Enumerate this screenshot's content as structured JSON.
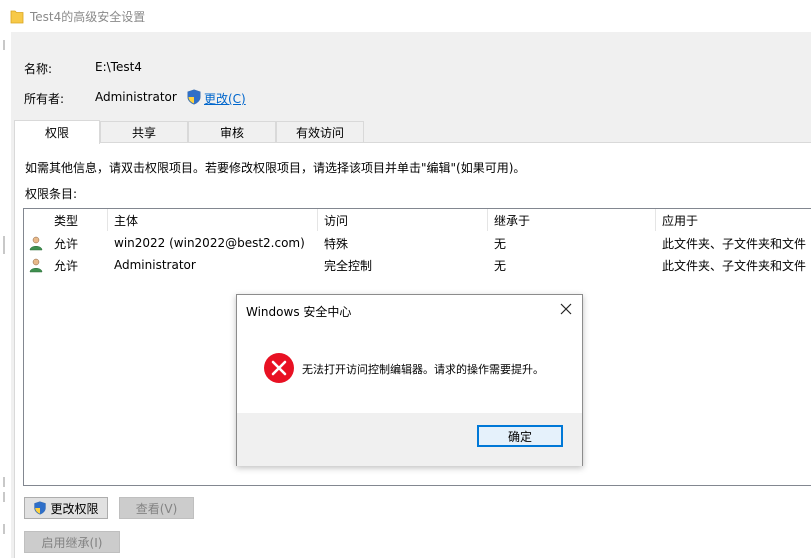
{
  "window": {
    "title": "Test4的高级安全设置"
  },
  "info": {
    "name_label": "名称:",
    "name_value": "E:\\Test4",
    "owner_label": "所有者:",
    "owner_value": "Administrator",
    "change_link": "更改(C)"
  },
  "tabs": [
    {
      "label": "权限",
      "active": true
    },
    {
      "label": "共享",
      "active": false
    },
    {
      "label": "审核",
      "active": false
    },
    {
      "label": "有效访问",
      "active": false
    }
  ],
  "permissions": {
    "hint": "如需其他信息，请双击权限项目。若要修改权限项目，请选择该项目并单击\"编辑\"(如果可用)。",
    "entries_label": "权限条目:",
    "columns": [
      "类型",
      "主体",
      "访问",
      "继承于",
      "应用于"
    ],
    "rows": [
      {
        "type": "允许",
        "principal": "win2022 (win2022@best2.com)",
        "access": "特殊",
        "inherited": "无",
        "applies": "此文件夹、子文件夹和文件"
      },
      {
        "type": "允许",
        "principal": "Administrator",
        "access": "完全控制",
        "inherited": "无",
        "applies": "此文件夹、子文件夹和文件"
      }
    ]
  },
  "buttons": {
    "change_permissions": "更改权限",
    "view": "查看(V)",
    "enable_inheritance": "启用继承(I)"
  },
  "dialog": {
    "title": "Windows 安全中心",
    "message": "无法打开访问控制编辑器。请求的操作需要提升。",
    "ok": "确定"
  },
  "colors": {
    "link": "#0066cc",
    "error": "#e81123",
    "accent": "#0078d7"
  }
}
